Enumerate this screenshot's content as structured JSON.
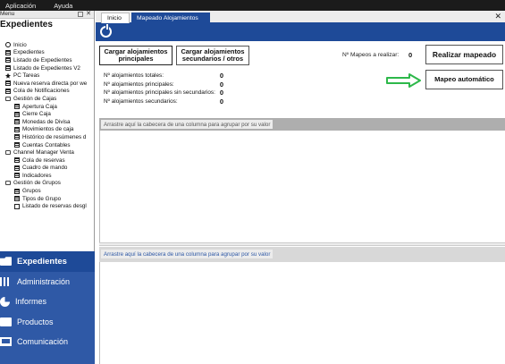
{
  "menubar": {
    "items": [
      "Aplicación",
      "Ayuda"
    ]
  },
  "left_panel": {
    "header_label": "Menu",
    "close_glyph": "✕",
    "title": "Expedientes",
    "tree": [
      {
        "label": "Inicio",
        "icon": "power-icon",
        "level": 0
      },
      {
        "label": "Expedientes",
        "icon": "grid-icon",
        "level": 0
      },
      {
        "label": "Listado de Expedientes",
        "icon": "grid-icon",
        "level": 0
      },
      {
        "label": "Listado de Expedientes V2",
        "icon": "grid-icon",
        "level": 0
      },
      {
        "label": "PC Tareas",
        "icon": "pc-icon",
        "level": 0
      },
      {
        "label": "Nueva reserva directa por we",
        "icon": "grid-icon",
        "level": 0
      },
      {
        "label": "Cola de Notificaciones",
        "icon": "grid-icon",
        "level": 0
      },
      {
        "label": "Gestión de Cajas",
        "icon": "folder-icon",
        "level": 0
      },
      {
        "label": "Apertura Caja",
        "icon": "grid-icon",
        "level": 1
      },
      {
        "label": "Cierre Caja",
        "icon": "grid-icon",
        "level": 1
      },
      {
        "label": "Monedas de Divisa",
        "icon": "grid-icon",
        "level": 1
      },
      {
        "label": "Movimientos de caja",
        "icon": "grid-icon",
        "level": 1
      },
      {
        "label": "Histórico de resúmenes d",
        "icon": "grid-icon",
        "level": 1
      },
      {
        "label": "Cuentas Contables",
        "icon": "grid-icon",
        "level": 1
      },
      {
        "label": "Channel Manager Venta",
        "icon": "folder-icon",
        "level": 0
      },
      {
        "label": "Cola de reservas",
        "icon": "grid-icon",
        "level": 1
      },
      {
        "label": "Cuadro de mando",
        "icon": "grid-icon",
        "level": 1
      },
      {
        "label": "Indicadores",
        "icon": "grid-icon",
        "level": 1
      },
      {
        "label": "Gestión de Grupos",
        "icon": "folder-icon",
        "level": 0
      },
      {
        "label": "Grupos",
        "icon": "grid-icon",
        "level": 1
      },
      {
        "label": "Tipos de Grupo",
        "icon": "grid-icon",
        "level": 1
      },
      {
        "label": "Listado de reservas desgl",
        "icon": "doc-icon",
        "level": 1
      }
    ]
  },
  "nav": {
    "items": [
      {
        "label": "Expedientes",
        "icon": "folder-icon",
        "active": true
      },
      {
        "label": "Administración",
        "icon": "bar-chart-icon",
        "active": false
      },
      {
        "label": "Informes",
        "icon": "pie-chart-icon",
        "active": false
      },
      {
        "label": "Productos",
        "icon": "bag-icon",
        "active": false
      },
      {
        "label": "Comunicación",
        "icon": "monitor-icon",
        "active": false
      }
    ]
  },
  "tabs": {
    "items": [
      "Inicio",
      "Mapeado Alojamientos"
    ],
    "active": "Mapeado Alojamientos",
    "close_glyph": "✕"
  },
  "toolbar": {
    "cargar_principales_line1": "Cargar alojamientos",
    "cargar_principales_line2": "principales",
    "cargar_secundarios_line1": "Cargar alojamientos",
    "cargar_secundarios_line2": "secundarios / otros",
    "realizar_mapeado": "Realizar mapeado",
    "mapeo_automatico": "Mapeo automático",
    "mapeos_label": "Nº Mapeos a realizar:",
    "mapeos_value": "0"
  },
  "stats": [
    {
      "label": "Nº alojamientos totales:",
      "value": "0"
    },
    {
      "label": "Nº alojamientos principales:",
      "value": "0"
    },
    {
      "label": "Nº alojamientos principales sin secundarios:",
      "value": "0"
    },
    {
      "label": "Nº alojamientos secundarios:",
      "value": "0"
    }
  ],
  "grid1": {
    "group_hint": "Arrastre aquí la cabecera de una columna para agrupar por su valor"
  },
  "grid2": {
    "group_hint": "Arrastre aquí la cabecera de una columna para agrupar por su valor"
  },
  "colors": {
    "accent_blue": "#1e4a98",
    "nav_blue": "#2f59a6",
    "arrow_green": "#2db84a",
    "menubar_bg": "#1b1b1b"
  }
}
